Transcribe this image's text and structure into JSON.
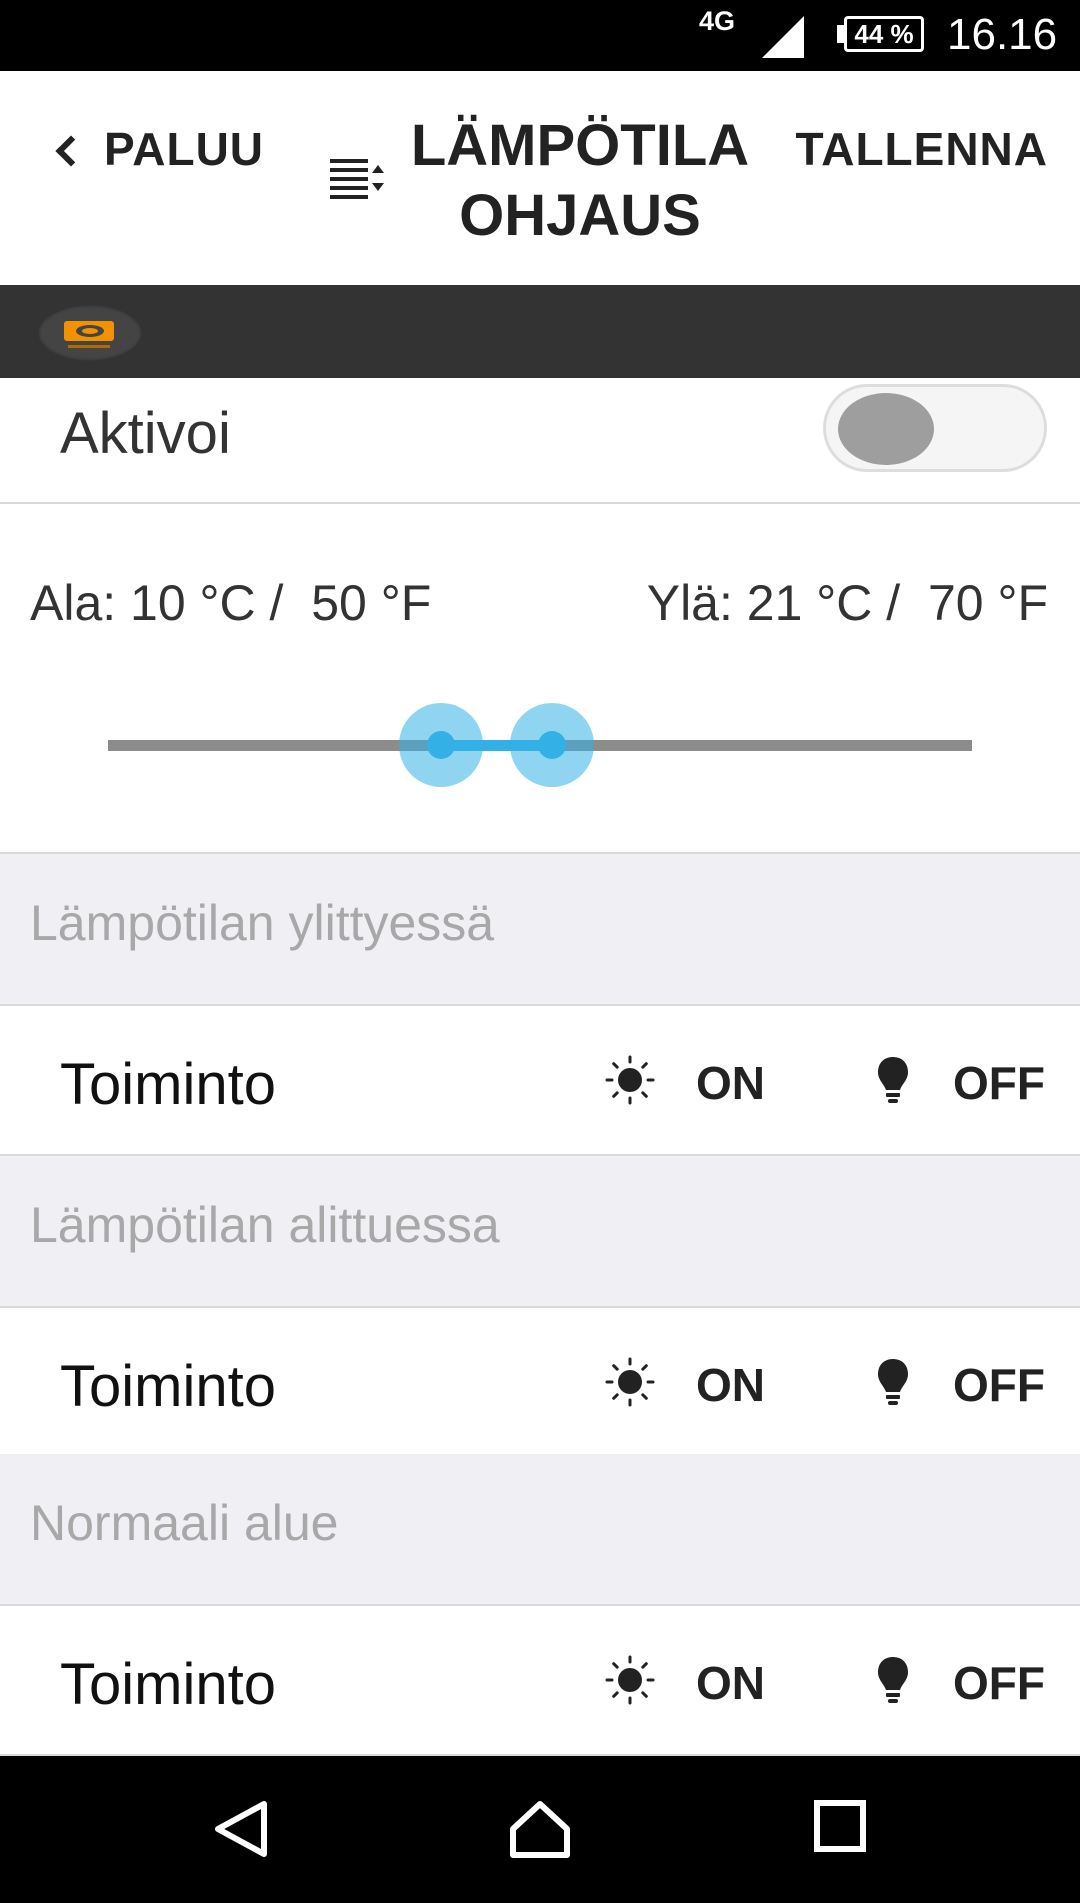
{
  "status_bar": {
    "network": "4G",
    "battery": "44 %",
    "time": "16.16",
    "icons": [
      "signal-icon",
      "battery-icon"
    ]
  },
  "header": {
    "back_label": "PALUU",
    "title_line1": "LÄMPÖTILA",
    "title_line2": "OHJAUS",
    "save_label": "TALLENNA",
    "icons": [
      "chevron-left-icon",
      "sort-list-icon"
    ]
  },
  "brand": {
    "logo_icon": "brand-logo-icon"
  },
  "activate": {
    "label": "Aktivoi",
    "enabled": false
  },
  "range": {
    "low_text": "Ala: 10 °C /  50 °F",
    "high_text": "Ylä: 21 °C /  70 °F",
    "low_fraction": 0.385,
    "high_fraction": 0.514,
    "accent": "#33b0e5"
  },
  "sections": [
    {
      "title": "Lämpötilan ylittyessä",
      "action_label": "Toiminto",
      "on_label": "ON",
      "off_label": "OFF"
    },
    {
      "title": "Lämpötilan alittuessa",
      "action_label": "Toiminto",
      "on_label": "ON",
      "off_label": "OFF"
    },
    {
      "title": "Normaali alue",
      "action_label": "Toiminto",
      "on_label": "ON",
      "off_label": "OFF"
    }
  ],
  "nav": {
    "icons": [
      "back-triangle-icon",
      "home-icon",
      "recents-square-icon"
    ]
  }
}
